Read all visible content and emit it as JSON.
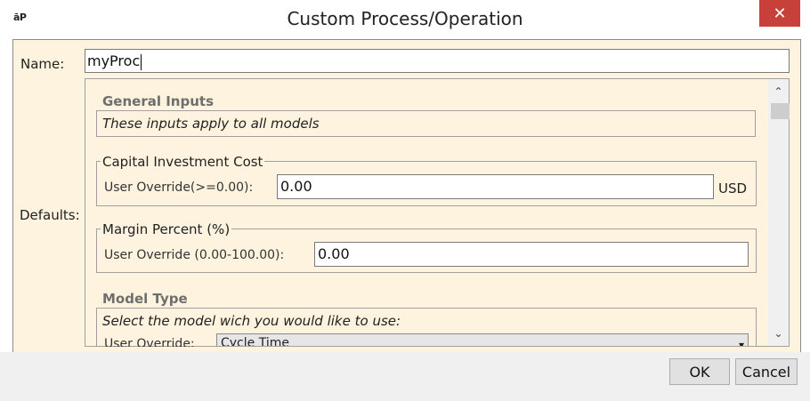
{
  "window": {
    "title": "Custom Process/Operation",
    "app_logo": "āP",
    "close_glyph": "✕"
  },
  "name_field": {
    "label": "Name:",
    "value": "myProc"
  },
  "defaults": {
    "label": "Defaults:"
  },
  "general_inputs": {
    "title": "General Inputs",
    "note": "These inputs apply to all models"
  },
  "capital_investment": {
    "title": "Capital Investment Cost",
    "override_label": "User Override(>=0.00):",
    "value": "0.00",
    "unit": "USD"
  },
  "margin_percent": {
    "title": "Margin Percent (%)",
    "override_label": "User Override (0.00-100.00):",
    "value": "0.00"
  },
  "model_type": {
    "title": "Model Type",
    "note": "Select the model wich you would like to use:",
    "override_label": "User Override:",
    "selected": "Cycle Time"
  },
  "scrollbar": {
    "up_glyph": "⌃",
    "down_glyph": "⌄"
  },
  "buttons": {
    "ok": "OK",
    "cancel": "Cancel"
  }
}
